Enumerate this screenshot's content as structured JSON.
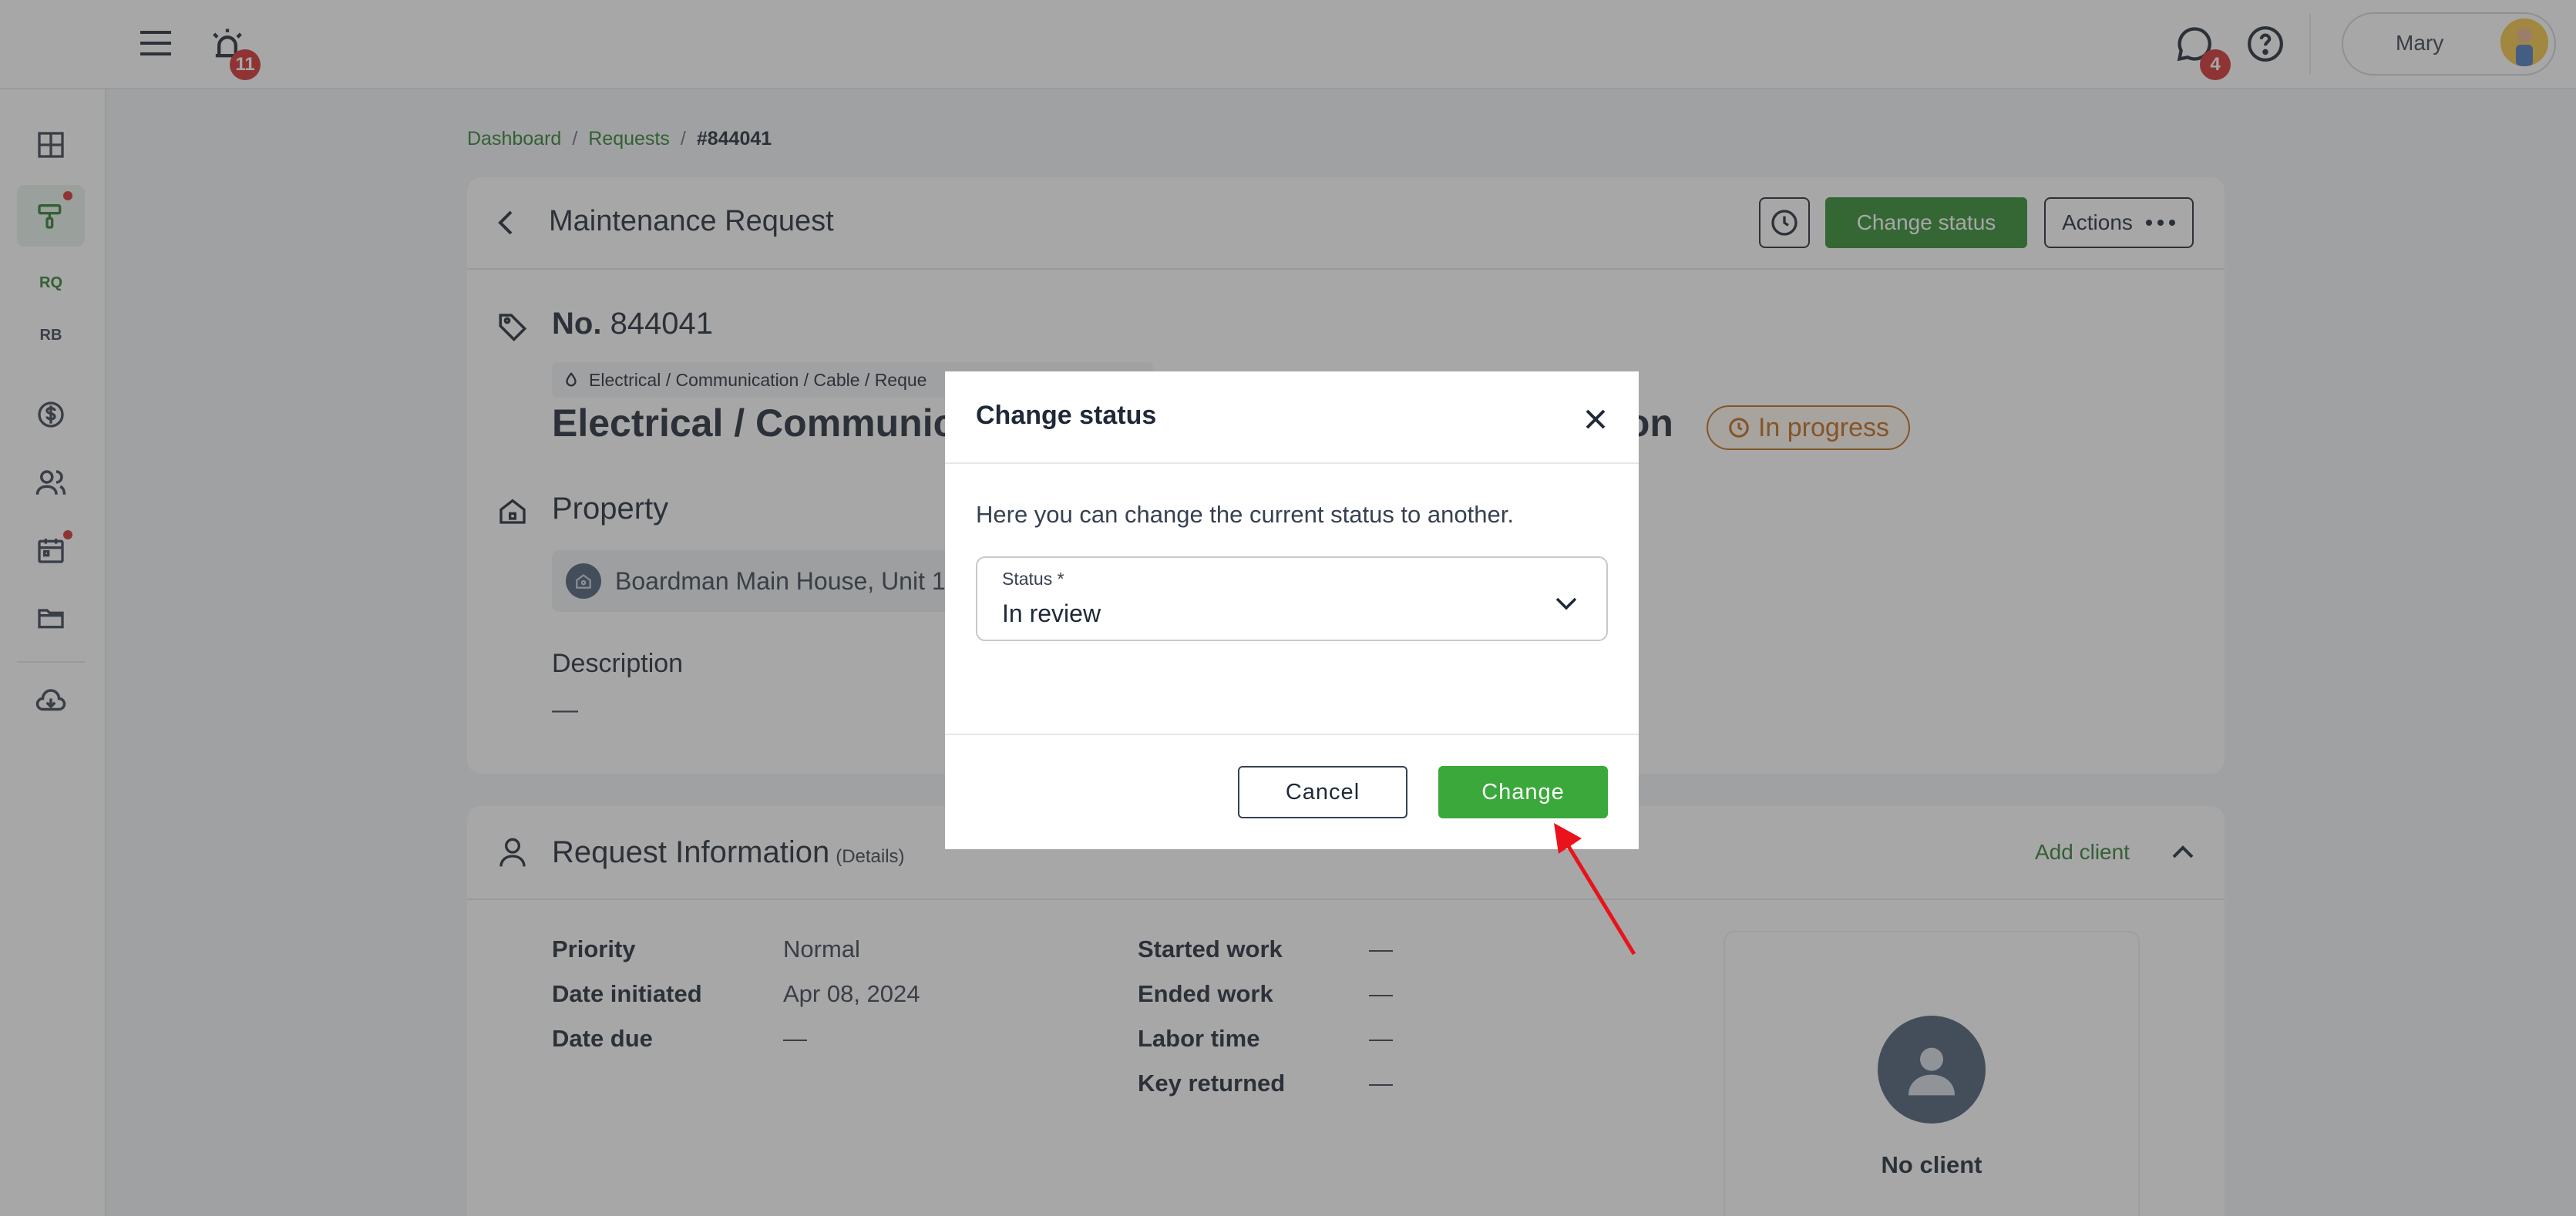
{
  "topbar": {
    "alarm_count": "11",
    "chat_count": "4",
    "user_name": "Mary"
  },
  "sidebar": {
    "items": [
      {
        "icon": "dashboard-icon"
      },
      {
        "icon": "maintenance-icon",
        "active": true
      },
      {
        "label": "RQ"
      },
      {
        "label": "RB"
      },
      {
        "icon": "dollar-icon"
      },
      {
        "icon": "people-icon"
      },
      {
        "icon": "calendar-icon"
      },
      {
        "icon": "folder-icon"
      },
      {
        "icon": "cloud-download-icon"
      }
    ]
  },
  "breadcrumb": {
    "items": [
      "Dashboard",
      "Requests",
      "#844041"
    ],
    "separator": "/"
  },
  "header": {
    "title": "Maintenance Request",
    "change_status_label": "Change status",
    "actions_label": "Actions"
  },
  "request": {
    "no_prefix": "No.",
    "number": "844041",
    "category": "Electrical / Communication / Cable / Reque",
    "title_visible": "Electrical / Communica",
    "title_tail": "ion",
    "status": "In progress",
    "property_heading": "Property",
    "property_name": "Boardman Main House, Unit 1",
    "description_heading": "Description",
    "description_value": "—"
  },
  "info": {
    "title": "Request Information",
    "subtitle": "(Details)",
    "add_client_label": "Add client",
    "left": [
      {
        "label": "Priority",
        "value": "Normal"
      },
      {
        "label": "Date initiated",
        "value": "Apr 08, 2024"
      },
      {
        "label": "Date due",
        "value": "—"
      }
    ],
    "right": [
      {
        "label": "Started work",
        "value": "—"
      },
      {
        "label": "Ended work",
        "value": "—"
      },
      {
        "label": "Labor time",
        "value": "—"
      },
      {
        "label": "Key returned",
        "value": "—"
      }
    ],
    "no_client_label": "No client"
  },
  "modal": {
    "title": "Change status",
    "description": "Here you can change the current status to another.",
    "status_label": "Status *",
    "status_value": "In review",
    "cancel_label": "Cancel",
    "change_label": "Change"
  },
  "colors": {
    "brand_green": "#2e8b2e",
    "status_orange": "#c06a19",
    "annotation_red": "#e8131b"
  }
}
